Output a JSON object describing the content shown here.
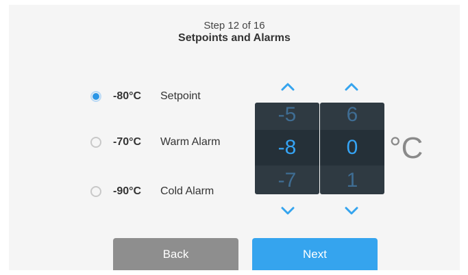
{
  "header": {
    "step": "Step 12 of 16",
    "title": "Setpoints and Alarms"
  },
  "options": [
    {
      "value": "-80°C",
      "label": "Setpoint",
      "selected": true
    },
    {
      "value": "-70°C",
      "label": "Warm Alarm",
      "selected": false
    },
    {
      "value": "-90°C",
      "label": "Cold Alarm",
      "selected": false
    }
  ],
  "picker": {
    "tens": {
      "prev": "-5",
      "current": "-8",
      "next": "-7"
    },
    "ones": {
      "prev": "6",
      "current": "0",
      "next": "1"
    },
    "unit": "°C"
  },
  "buttons": {
    "back": "Back",
    "next": "Next"
  },
  "colors": {
    "accent": "#35a4ee",
    "radio_selected": "#2b96e6",
    "wheel_bg": "#2f3a42",
    "wheel_current_text": "#35a4f5",
    "wheel_faded_text": "#3f6d93",
    "back_button": "#8e8e8e"
  },
  "icons": {
    "increment": "chevron-up-icon",
    "decrement": "chevron-down-icon"
  }
}
